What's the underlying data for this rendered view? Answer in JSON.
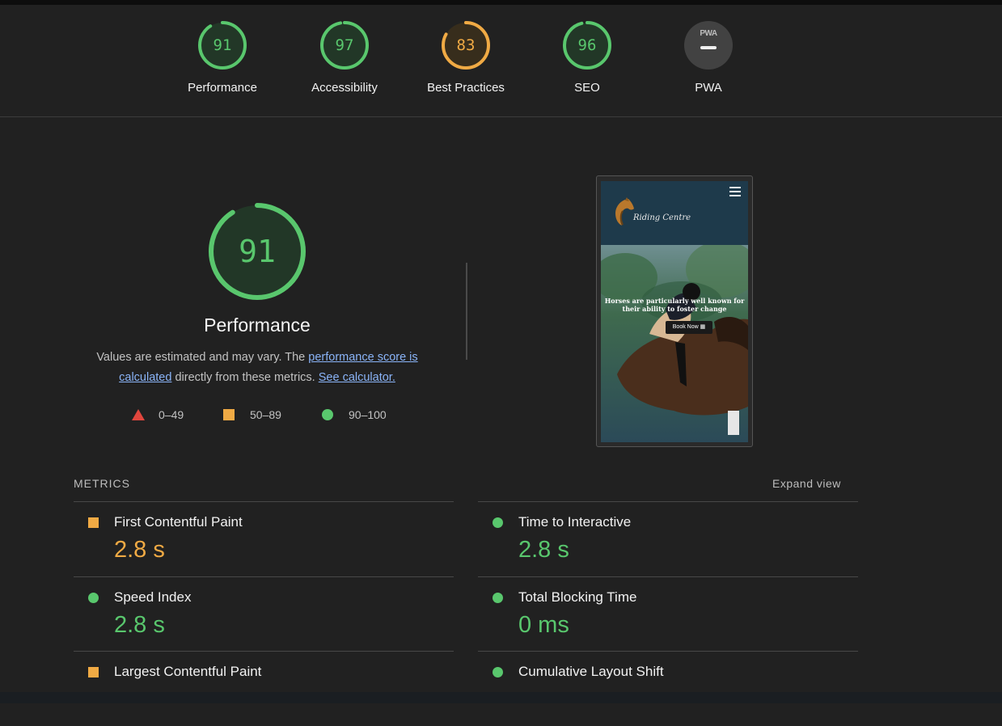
{
  "colors": {
    "pass": "#59c76d",
    "average": "#f0aa44",
    "fail": "#e0463d",
    "track_pass": "#254a2e",
    "track_average": "#4a3819",
    "neutral": "#424242"
  },
  "categories": [
    {
      "label": "Performance",
      "score": "91",
      "level": "pass",
      "fraction": 0.91
    },
    {
      "label": "Accessibility",
      "score": "97",
      "level": "pass",
      "fraction": 0.97
    },
    {
      "label": "Best Practices",
      "score": "83",
      "level": "average",
      "fraction": 0.83
    },
    {
      "label": "SEO",
      "score": "96",
      "level": "pass",
      "fraction": 0.96
    },
    {
      "label": "PWA",
      "badge": "PWA"
    }
  ],
  "performance": {
    "score": "91",
    "fraction": 0.91,
    "title": "Performance",
    "desc_prefix": "Values are estimated and may vary. The ",
    "desc_link1": "performance score is calculated",
    "desc_middle": " directly from these metrics. ",
    "desc_link2": "See calculator."
  },
  "legend": [
    {
      "icon": "fail-triangle-icon",
      "range": "0–49"
    },
    {
      "icon": "average-square-icon",
      "range": "50–89"
    },
    {
      "icon": "pass-circle-icon",
      "range": "90–100"
    }
  ],
  "thumbnail": {
    "logo_text": "Riding Centre",
    "hero_caption": "Horses are particularly well known for their ability to foster change",
    "book_button": "Book Now ▦"
  },
  "metrics": {
    "title": "METRICS",
    "expand": "Expand view",
    "items": [
      {
        "name": "First Contentful Paint",
        "value": "2.8 s",
        "level": "average"
      },
      {
        "name": "Time to Interactive",
        "value": "2.8 s",
        "level": "pass"
      },
      {
        "name": "Speed Index",
        "value": "2.8 s",
        "level": "pass"
      },
      {
        "name": "Total Blocking Time",
        "value": "0 ms",
        "level": "pass"
      },
      {
        "name": "Largest Contentful Paint",
        "level": "average"
      },
      {
        "name": "Cumulative Layout Shift",
        "level": "pass"
      }
    ]
  }
}
